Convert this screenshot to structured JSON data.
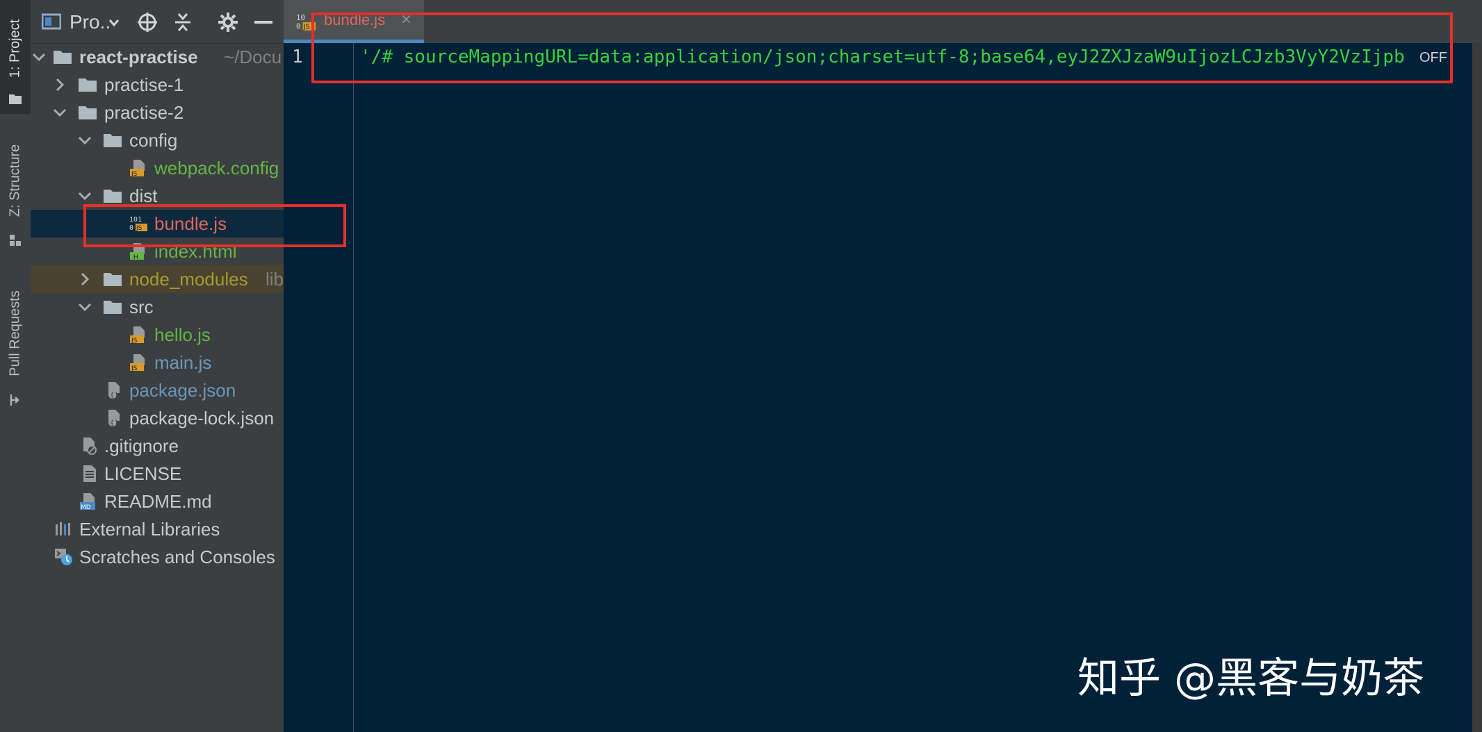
{
  "toolstripe": {
    "project_label": "1: Project",
    "structure_label": "Z: Structure",
    "pull_requests_label": "Pull Requests"
  },
  "project_toolbar": {
    "title": "Pro..",
    "icons": [
      "project-view-icon",
      "locate-icon",
      "collapse-all-icon",
      "gear-icon",
      "minimize-icon"
    ]
  },
  "tree": [
    {
      "name": "react-practise",
      "suffix": "~/Docu",
      "kind": "folder",
      "state": "expanded"
    },
    {
      "name": "practise-1",
      "kind": "folder",
      "state": "collapsed"
    },
    {
      "name": "practise-2",
      "kind": "folder",
      "state": "expanded"
    },
    {
      "name": "config",
      "kind": "folder",
      "state": "expanded"
    },
    {
      "name": "webpack.config",
      "kind": "js-file"
    },
    {
      "name": "dist",
      "kind": "folder",
      "state": "expanded"
    },
    {
      "name": "bundle.js",
      "kind": "binary-js-file"
    },
    {
      "name": "index.html",
      "kind": "html-file"
    },
    {
      "name": "node_modules",
      "suffix": "lib",
      "kind": "folder",
      "state": "collapsed"
    },
    {
      "name": "src",
      "kind": "folder",
      "state": "expanded"
    },
    {
      "name": "hello.js",
      "kind": "js-file"
    },
    {
      "name": "main.js",
      "kind": "js-file"
    },
    {
      "name": "package.json",
      "kind": "json-file"
    },
    {
      "name": "package-lock.json",
      "kind": "json-file"
    },
    {
      "name": ".gitignore",
      "kind": "gitignore-file"
    },
    {
      "name": "LICENSE",
      "kind": "text-file"
    },
    {
      "name": "README.md",
      "kind": "md-file"
    },
    {
      "name": "External Libraries",
      "kind": "libraries"
    },
    {
      "name": "Scratches and Consoles",
      "kind": "scratches"
    }
  ],
  "editor": {
    "tab_label": "bundle.js",
    "tab_close": "✕",
    "line_number": "1",
    "code_text": "'/# sourceMappingURL=data:application/json;charset=utf-8;base64,eyJ2ZXJzaW9uIjozLCJzb3VyY2VzIjpb",
    "hint": "OFF"
  },
  "watermark": "知乎 @黑客与奶茶",
  "colors": {
    "highlight_box": "#e3302a",
    "editor_bg": "#012139",
    "code_green": "#36d13a"
  }
}
